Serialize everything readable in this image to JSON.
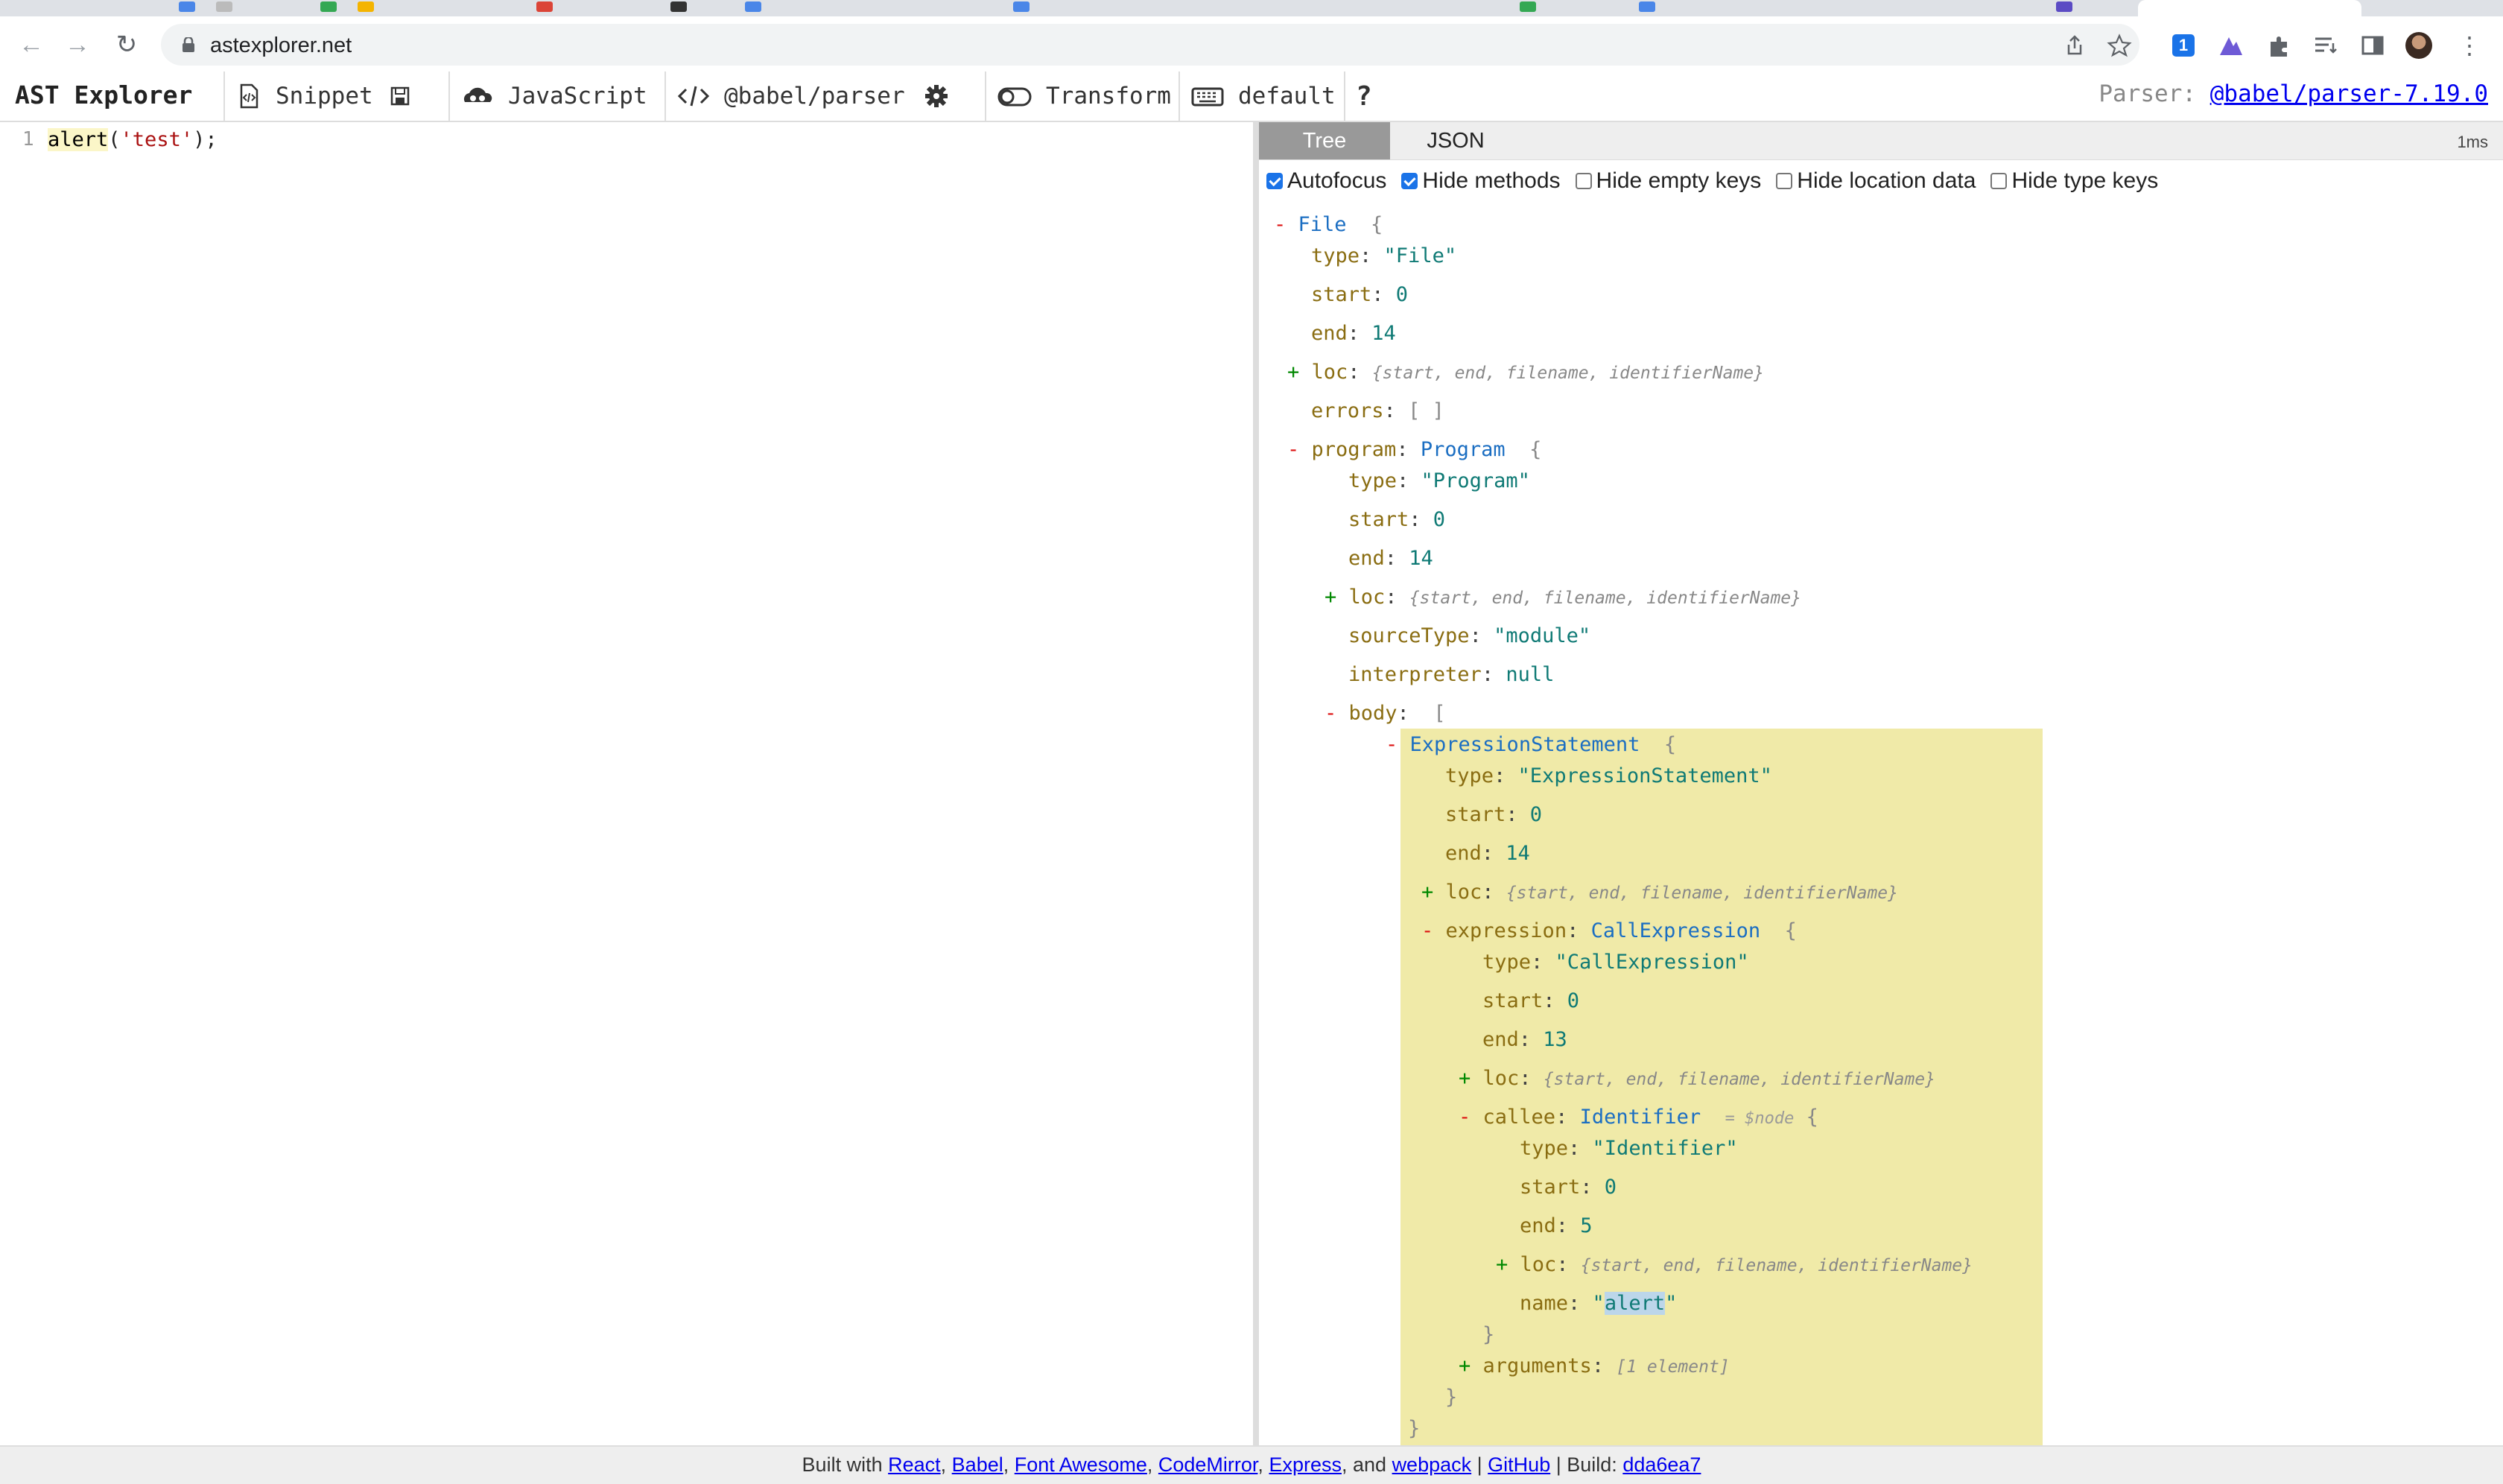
{
  "browser": {
    "url": "astexplorer.net",
    "icons": [
      "back-icon",
      "forward-icon",
      "reload-icon",
      "lock-icon",
      "share-icon",
      "bookmark-star-icon",
      "extensions-icon",
      "reading-list-icon",
      "side-panel-icon",
      "profile-avatar",
      "kebab-menu-icon"
    ]
  },
  "toolbar": {
    "title": "AST Explorer",
    "snippet": "Snippet",
    "language": "JavaScript",
    "parser": "@babel/parser",
    "transform": "Transform",
    "keymap": "default",
    "help": "?",
    "parser_info_label": "Parser:",
    "parser_info_link": "@babel/parser-7.19.0"
  },
  "editor": {
    "line_number": "1",
    "code": {
      "fn": "alert",
      "open": "(",
      "str": "'test'",
      "close": ");"
    }
  },
  "output": {
    "tabs": [
      "Tree",
      "JSON"
    ],
    "timing": "1ms",
    "options": [
      {
        "label": "Autofocus",
        "checked": true
      },
      {
        "label": "Hide methods",
        "checked": true
      },
      {
        "label": "Hide empty keys",
        "checked": false
      },
      {
        "label": "Hide location data",
        "checked": false
      },
      {
        "label": "Hide type keys",
        "checked": false
      }
    ],
    "loc_summary": "{start, end, filename, identifierName}",
    "tree": {
      "file": {
        "name": "File",
        "type_key": "type",
        "type_val": "\"File\"",
        "start": "0",
        "end": "14",
        "errors_key": "errors",
        "errors_val": "[ ]"
      },
      "program": {
        "key": "program",
        "name": "Program",
        "type_val": "\"Program\"",
        "start": "0",
        "end": "14",
        "sourceType_key": "sourceType",
        "sourceType_val": "\"module\"",
        "interpreter_key": "interpreter",
        "interpreter_val": "null",
        "body_key": "body"
      },
      "stmt": {
        "name": "ExpressionStatement",
        "type_val": "\"ExpressionStatement\"",
        "start": "0",
        "end": "14"
      },
      "expr": {
        "key": "expression",
        "name": "CallExpression",
        "type_val": "\"CallExpression\"",
        "start": "0",
        "end": "13",
        "arguments_key": "arguments",
        "arguments_val": "[1 element]"
      },
      "callee": {
        "key": "callee",
        "name": "Identifier",
        "ref": "= $node",
        "type_val": "\"Identifier\"",
        "start": "0",
        "end": "5",
        "name_key": "name",
        "name_val": "alert"
      }
    }
  },
  "footer": {
    "prefix": "Built with",
    "links": [
      "React",
      "Babel",
      "Font Awesome",
      "CodeMirror",
      "Express",
      "webpack",
      "GitHub",
      "dda6ea7"
    ],
    "and": ", and",
    "build_label": "Build:"
  },
  "colors": {
    "highlight": "#f0eaa8",
    "link": "#0000ee",
    "active_tab": "#999999"
  }
}
